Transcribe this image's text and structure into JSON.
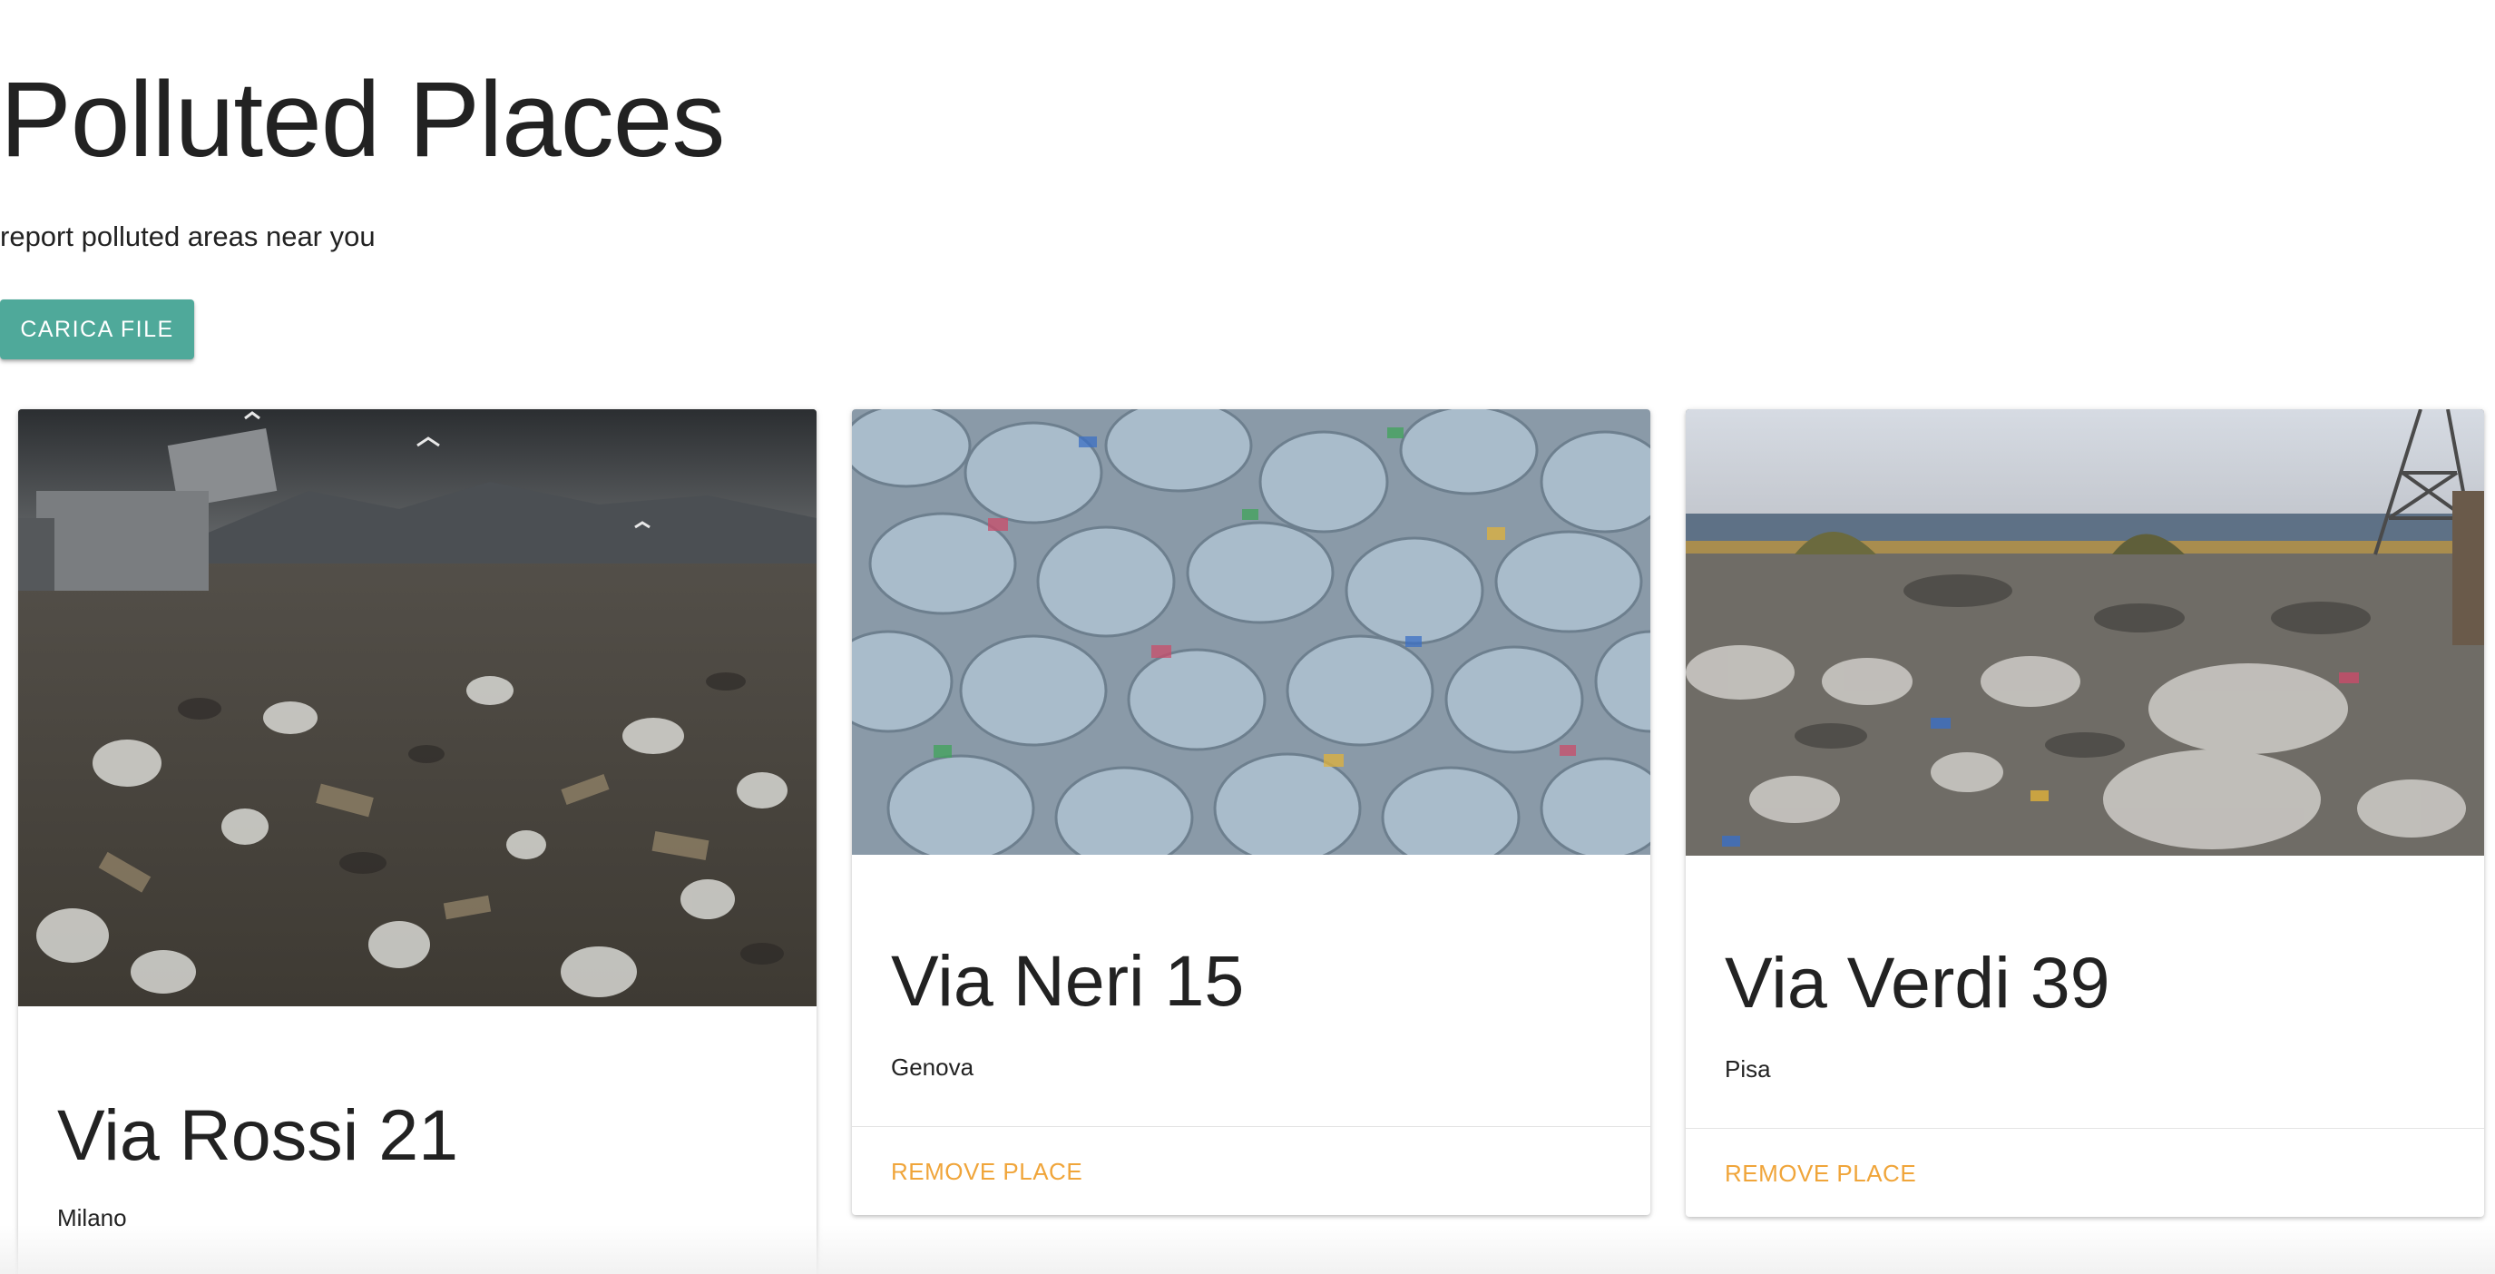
{
  "header": {
    "title": "Polluted Places",
    "subtitle": "report polluted areas near you",
    "upload_label": "CARICA FILE"
  },
  "places": [
    {
      "title": "Via Rossi 21",
      "city": "Milano",
      "image_alt": "landfill with garbage trucks and seagulls"
    },
    {
      "title": "Via Neri 15",
      "city": "Genova",
      "remove_label": "REMOVE PLACE",
      "image_alt": "pile of plastic garbage bags"
    },
    {
      "title": "Via Verdi 39",
      "city": "Pisa",
      "remove_label": "REMOVE PLACE",
      "image_alt": "illegal dump near the sea"
    }
  ],
  "colors": {
    "primary": "#4fa99a",
    "accent": "#f0a53a",
    "text": "#222222"
  }
}
